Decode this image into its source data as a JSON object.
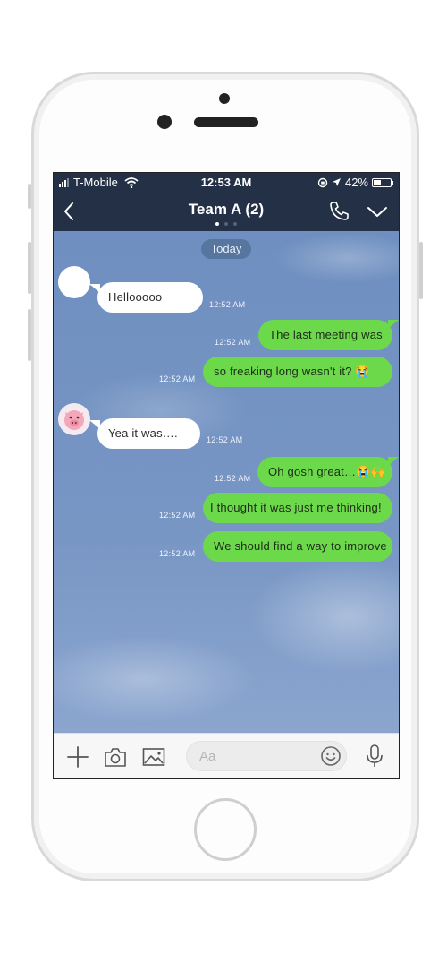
{
  "status_bar": {
    "carrier": "T-Mobile",
    "time": "12:53 AM",
    "battery": "42%",
    "battery_level": 0.42
  },
  "header": {
    "title": "Team A (2)",
    "page_dots": 3,
    "active_dot": 0
  },
  "chat": {
    "date_label": "Today",
    "messages": [
      {
        "side": "in",
        "avatar": "blank",
        "text": "Hellooooo",
        "time": "12:52 AM"
      },
      {
        "side": "out",
        "text": "The last meeting was",
        "time": "12:52 AM"
      },
      {
        "side": "out",
        "text": "so freaking long wasn't it? 😭",
        "time": "12:52 AM"
      },
      {
        "side": "in",
        "avatar": "pig",
        "text": "Yea it was….",
        "time": "12:52 AM"
      },
      {
        "side": "out",
        "text": "Oh gosh great…😭🙌",
        "time": "12:52 AM"
      },
      {
        "side": "out",
        "text": "I thought it was just me thinking!",
        "time": "12:52 AM"
      },
      {
        "side": "out",
        "text": "We should find a way to improve",
        "time": "12:52 AM"
      }
    ]
  },
  "composer": {
    "placeholder": "Aa",
    "icons": [
      "plus-icon",
      "camera-icon",
      "image-icon",
      "emoji-icon",
      "microphone-icon"
    ]
  },
  "colors": {
    "header_bg": "#233045",
    "outgoing_bubble": "#6bd94a",
    "incoming_bubble": "#ffffff",
    "chat_bg": "#6f91bf"
  }
}
